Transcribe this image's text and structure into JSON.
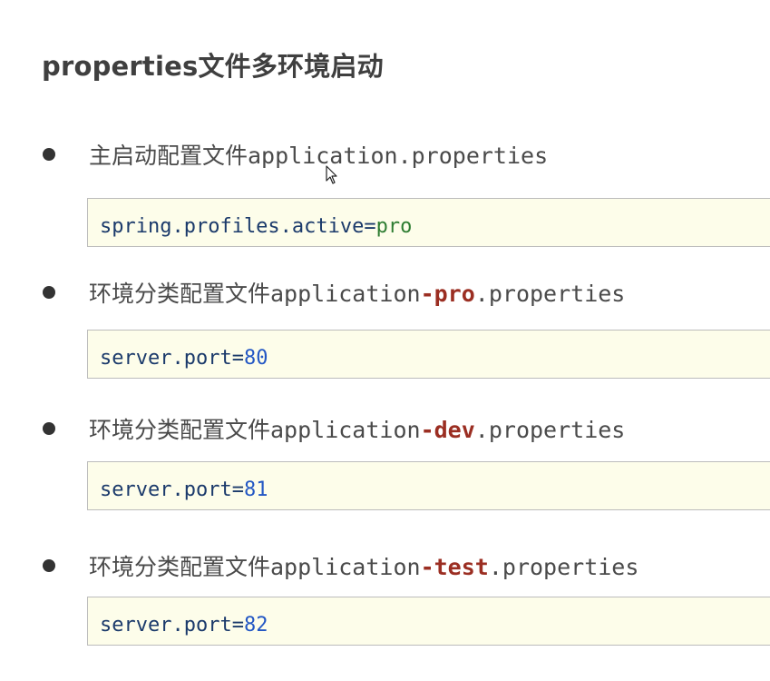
{
  "title": "properties文件多环境启动",
  "items": [
    {
      "prefix": "主启动配置文件application",
      "highlight": "",
      "suffix": ".properties",
      "code_key": "spring.profiles.active",
      "code_eq": "=",
      "code_value": "pro",
      "code_value_type": "string"
    },
    {
      "prefix": "环境分类配置文件application",
      "highlight": "-pro",
      "suffix": ".properties",
      "code_key": "server.port",
      "code_eq": "=",
      "code_value": "80",
      "code_value_type": "number"
    },
    {
      "prefix": "环境分类配置文件application",
      "highlight": "-dev",
      "suffix": ".properties",
      "code_key": "server.port",
      "code_eq": "=",
      "code_value": "81",
      "code_value_type": "number"
    },
    {
      "prefix": "环境分类配置文件application",
      "highlight": "-test",
      "suffix": ".properties",
      "code_key": "server.port",
      "code_eq": "=",
      "code_value": "82",
      "code_value_type": "number"
    }
  ],
  "colors": {
    "highlight": "#9b2e22",
    "code_background": "#fdfdea",
    "code_key": "#1b3a6b",
    "code_string": "#2e7d32",
    "code_number": "#2357c4"
  },
  "icons": {
    "bullet": "bullet-dot-icon",
    "cursor": "mouse-pointer-icon"
  }
}
